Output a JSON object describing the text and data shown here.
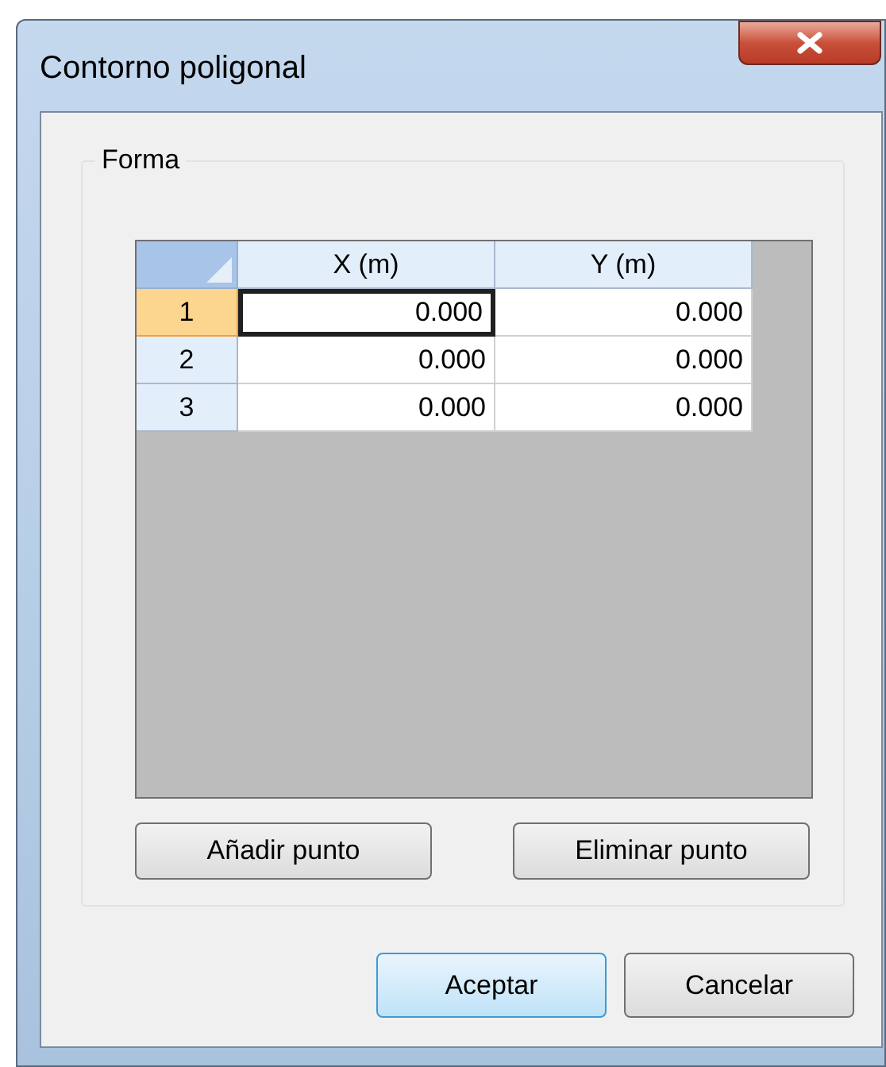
{
  "window": {
    "title": "Contorno poligonal"
  },
  "group": {
    "title": "Forma"
  },
  "table": {
    "columns": [
      "X (m)",
      "Y (m)"
    ],
    "rows": [
      {
        "label": "1",
        "selected": true,
        "cells": [
          {
            "value": "0.000",
            "selected": true
          },
          {
            "value": "0.000",
            "selected": false
          }
        ]
      },
      {
        "label": "2",
        "selected": false,
        "cells": [
          {
            "value": "0.000",
            "selected": false
          },
          {
            "value": "0.000",
            "selected": false
          }
        ]
      },
      {
        "label": "3",
        "selected": false,
        "cells": [
          {
            "value": "0.000",
            "selected": false
          },
          {
            "value": "0.000",
            "selected": false
          }
        ]
      }
    ]
  },
  "group_buttons": [
    "Añadir punto",
    "Eliminar punto"
  ],
  "buttons": [
    {
      "label": "Aceptar",
      "default": true
    },
    {
      "label": "Cancelar",
      "default": false
    }
  ]
}
